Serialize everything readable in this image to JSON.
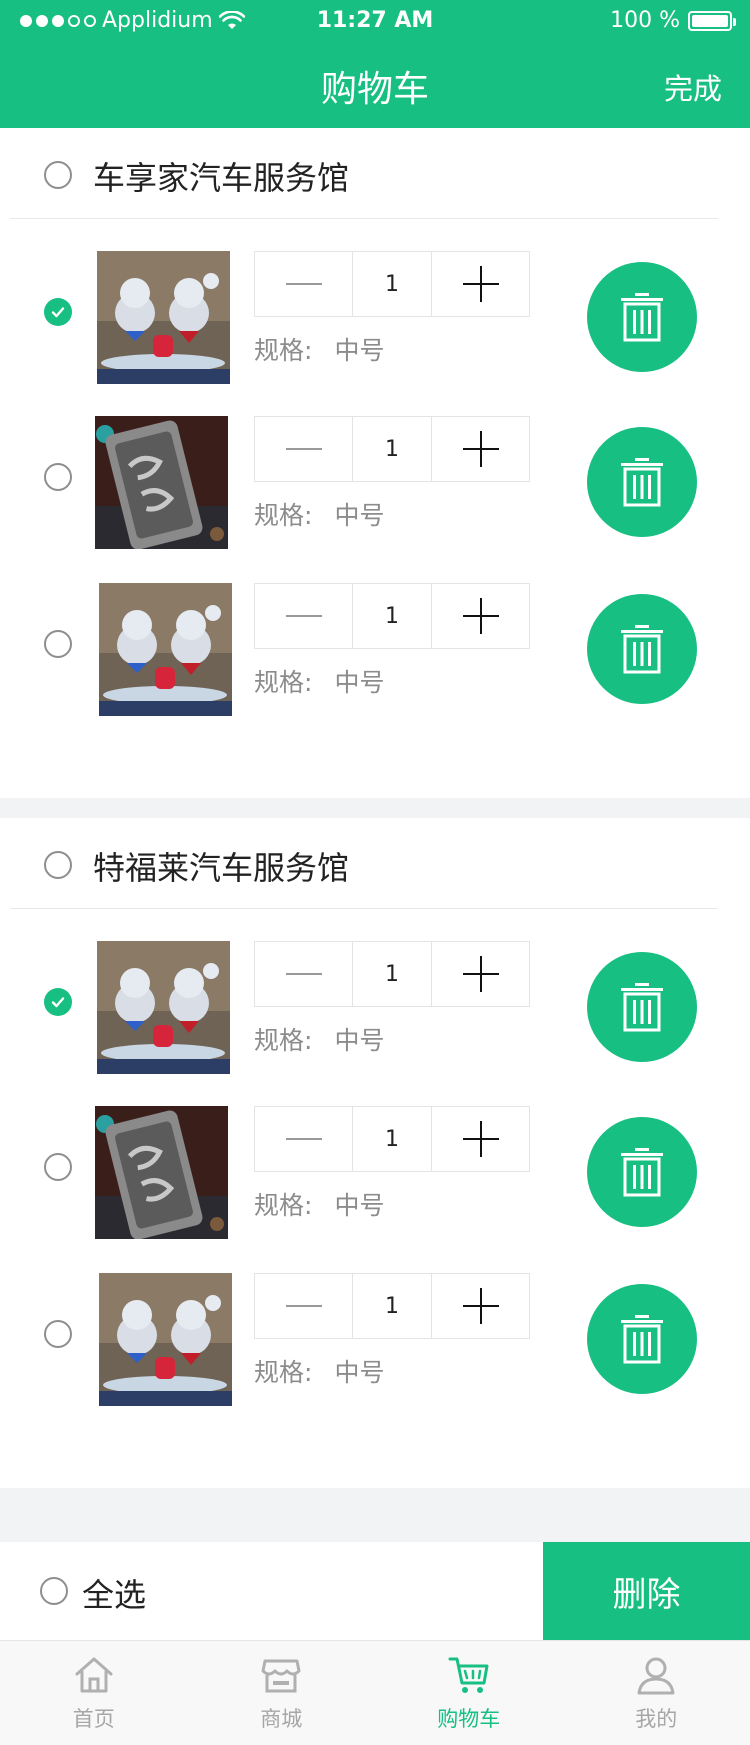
{
  "status_bar": {
    "carrier": "Applidium",
    "time": "11:27 AM",
    "battery": "100 %"
  },
  "header": {
    "title": "购物车",
    "done_label": "完成"
  },
  "colors": {
    "accent": "#18bf83",
    "text": "#222222",
    "muted": "#8c8c8c",
    "background": "#f2f3f5"
  },
  "stores": [
    {
      "name": "车享家汽车服务馆",
      "checked": false,
      "items": [
        {
          "image": "crystal-bears",
          "quantity": "1",
          "spec_label": "规格:",
          "spec_value": "中号",
          "checked": true
        },
        {
          "image": "ornamental-plaque",
          "quantity": "1",
          "spec_label": "规格:",
          "spec_value": "中号",
          "checked": false
        },
        {
          "image": "crystal-bears",
          "quantity": "1",
          "spec_label": "规格:",
          "spec_value": "中号",
          "checked": false
        }
      ]
    },
    {
      "name": "特福莱汽车服务馆",
      "checked": false,
      "items": [
        {
          "image": "crystal-bears",
          "quantity": "1",
          "spec_label": "规格:",
          "spec_value": "中号",
          "checked": true
        },
        {
          "image": "ornamental-plaque",
          "quantity": "1",
          "spec_label": "规格:",
          "spec_value": "中号",
          "checked": false
        },
        {
          "image": "crystal-bears",
          "quantity": "1",
          "spec_label": "规格:",
          "spec_value": "中号",
          "checked": false
        }
      ]
    }
  ],
  "action_bar": {
    "select_all_label": "全选",
    "delete_label": "删除"
  },
  "tabbar": {
    "tabs": [
      {
        "label": "首页",
        "icon": "home-icon",
        "active": false
      },
      {
        "label": "商城",
        "icon": "store-icon",
        "active": false
      },
      {
        "label": "购物车",
        "icon": "cart-icon",
        "active": true
      },
      {
        "label": "我的",
        "icon": "user-icon",
        "active": false
      }
    ]
  }
}
